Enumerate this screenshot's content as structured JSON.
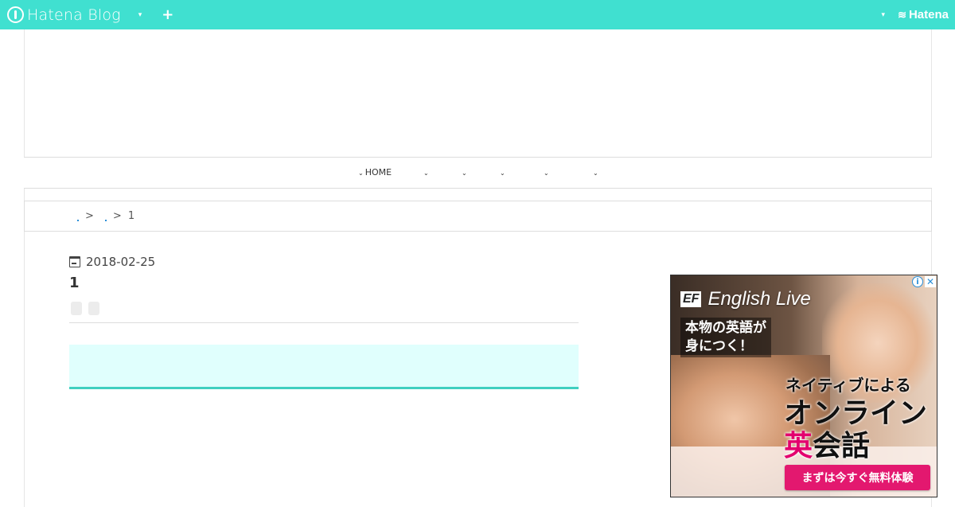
{
  "topbar": {
    "logo_text": "Hatena Blog",
    "dropdown_caret": "▾",
    "add_label": "+",
    "brand": "Hatena",
    "brand_icon": "≋",
    "bg_color": "#40e0d0"
  },
  "nav": {
    "items": [
      {
        "label": "HOME",
        "caret": "⌄"
      },
      {
        "label": "",
        "caret": "⌄"
      },
      {
        "label": "",
        "caret": "⌄"
      },
      {
        "label": "",
        "caret": "⌄"
      },
      {
        "label": "",
        "caret": "⌄"
      },
      {
        "label": "",
        "caret": "⌄"
      }
    ]
  },
  "breadcrumb": {
    "separator": ">",
    "current": "1"
  },
  "article": {
    "date": "2018-02-25",
    "title": "1"
  },
  "ad": {
    "ef_logo": "EF",
    "brand": "English Live",
    "sub_line1": "本物の英語が",
    "sub_line2": "身につく！",
    "head_line1": "ネイティブによる",
    "head_line2": "オンライン",
    "head_accent": "英",
    "head_line3_rest": "会話",
    "cta": "まずは今すぐ無料体験",
    "info_icon": "i",
    "close_icon": "✕",
    "accent_color": "#e3006e"
  }
}
